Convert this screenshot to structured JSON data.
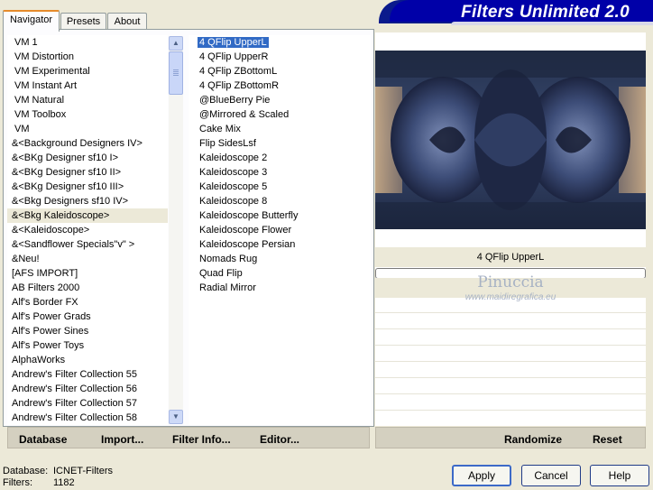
{
  "tabs": [
    {
      "label": "Navigator"
    },
    {
      "label": "Presets"
    },
    {
      "label": "About"
    }
  ],
  "title": "Filters Unlimited 2.0",
  "categories": [
    "VM 1",
    "VM Distortion",
    "VM Experimental",
    "VM Instant Art",
    "VM Natural",
    "VM Toolbox",
    "VM",
    "&<Background Designers IV>",
    "&<BKg Designer sf10 I>",
    "&<BKg Designer sf10 II>",
    "&<BKg Designer sf10 III>",
    "&<Bkg Designers sf10 IV>",
    "&<Bkg Kaleidoscope>",
    "&<Kaleidoscope>",
    "&<Sandflower Specials\"v\" >",
    "&Neu!",
    "[AFS IMPORT]",
    "AB Filters 2000",
    "Alf's Border FX",
    "Alf's Power Grads",
    "Alf's Power Sines",
    "Alf's Power Toys",
    "AlphaWorks",
    "Andrew's Filter Collection 55",
    "Andrew's Filter Collection 56",
    "Andrew's Filter Collection 57",
    "Andrew's Filter Collection 58"
  ],
  "filters": [
    "4 QFlip UpperL",
    "4 QFlip UpperR",
    "4 QFlip ZBottomL",
    "4 QFlip ZBottomR",
    "@BlueBerry Pie",
    "@Mirrored & Scaled",
    "Cake Mix",
    "Flip SidesLsf",
    "Kaleidoscope 2",
    "Kaleidoscope 3",
    "Kaleidoscope 5",
    "Kaleidoscope 8",
    "Kaleidoscope Butterfly",
    "Kaleidoscope Flower",
    "Kaleidoscope Persian",
    "Nomads Rug",
    "Quad Flip",
    "Radial Mirror"
  ],
  "selected_filter_name": "4 QFlip UpperL",
  "watermark": {
    "line1": "Pinuccia",
    "line2": "www.maidiregrafica.eu"
  },
  "nav_buttons": {
    "database": "Database",
    "import": "Import...",
    "filter_info": "Filter Info...",
    "editor": "Editor..."
  },
  "right_buttons": {
    "randomize": "Randomize",
    "reset": "Reset"
  },
  "status": {
    "database_label": "Database:",
    "database_value": "ICNET-Filters",
    "filters_label": "Filters:",
    "filters_value": "1182"
  },
  "dialog_buttons": {
    "apply": "Apply",
    "cancel": "Cancel",
    "help": "Help"
  },
  "colors": {
    "title_bg": "#0000a8",
    "selection": "#316ac5",
    "tab_accent": "#e68b2c"
  }
}
